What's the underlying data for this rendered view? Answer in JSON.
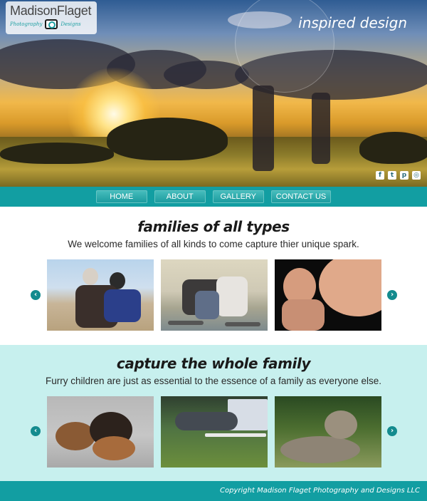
{
  "header": {
    "logo_name": "MadisonFlaget",
    "logo_sub_left": "Photography",
    "logo_sub_right": "Designs",
    "tagline": "inspired design",
    "social_icons": [
      "facebook-icon",
      "twitter-icon",
      "pinterest-icon",
      "instagram-icon"
    ],
    "social_glyphs": [
      "f",
      "t",
      "p",
      "◎"
    ]
  },
  "nav": {
    "items": [
      "HOME",
      "ABOUT",
      "GALLERY",
      "CONTACT US"
    ]
  },
  "sections": [
    {
      "title": "families of all types",
      "text": "We welcome families of all kinds to come capture thier unique spark.",
      "photos": [
        "grandparents-photo",
        "family-group-photo",
        "child-pregnant-belly-photo"
      ]
    },
    {
      "title": "capture the whole family",
      "text": "Furry children are just as essential to the essence of a family as everyone else.",
      "photos": [
        "puppies-photo",
        "dog-agility-photo",
        "cat-photo"
      ]
    }
  ],
  "carousel": {
    "prev_glyph": "‹",
    "next_glyph": "›"
  },
  "footer": {
    "copyright": "Copyright Madison Flaget Photography and Designs LLC"
  },
  "colors": {
    "teal": "#129ea2",
    "light_teal": "#c7f0ee",
    "arrow": "#138b8e"
  }
}
